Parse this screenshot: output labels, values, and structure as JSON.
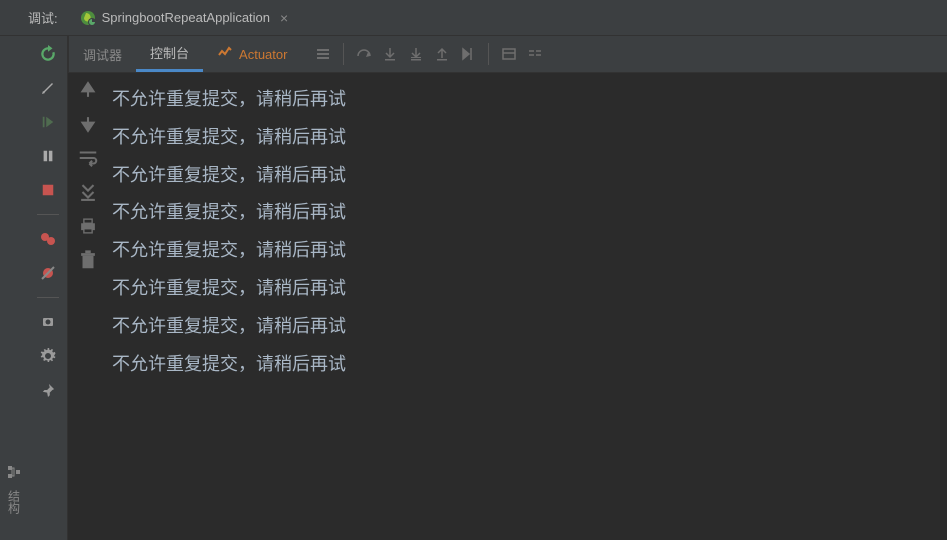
{
  "debug_label": "调试:",
  "run_config_name": "SpringbootRepeatApplication",
  "tabs": {
    "debugger": "调试器",
    "console": "控制台",
    "actuator": "Actuator"
  },
  "vertical_strip_label": "结构",
  "console_lines": [
    "不允许重复提交，请稍后再试",
    "不允许重复提交，请稍后再试",
    "不允许重复提交，请稍后再试",
    "不允许重复提交，请稍后再试",
    "不允许重复提交，请稍后再试",
    "不允许重复提交，请稍后再试",
    "不允许重复提交，请稍后再试",
    "不允许重复提交，请稍后再试"
  ]
}
